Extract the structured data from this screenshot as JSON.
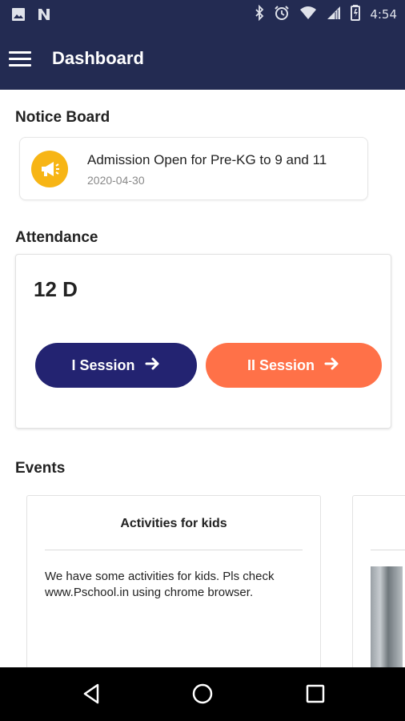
{
  "status_bar": {
    "time": "4:54",
    "left_icons": [
      "image-icon",
      "n-icon"
    ],
    "right_icons": [
      "bluetooth-icon",
      "alarm-icon",
      "wifi-icon",
      "signal-icon",
      "battery-icon"
    ]
  },
  "app_bar": {
    "title": "Dashboard",
    "menu_icon": "hamburger-menu-icon",
    "background": "#232b52"
  },
  "notice_board": {
    "heading": "Notice Board",
    "items": [
      {
        "title": "Admission Open for Pre-KG to 9 and 11",
        "date": "2020-04-30",
        "icon": "megaphone-icon",
        "icon_color": "#f7b515"
      }
    ]
  },
  "attendance": {
    "heading": "Attendance",
    "class_name": "12 D",
    "sessions": [
      {
        "label": "I Session",
        "icon": "arrow-right-icon",
        "color": "#232371"
      },
      {
        "label": "II Session",
        "icon": "arrow-right-icon",
        "color": "#ff7148"
      }
    ]
  },
  "events": {
    "heading": "Events",
    "items": [
      {
        "title": "Activities for kids",
        "description": "We have some activities for kids. Pls check www.Pschool.in using chrome browser."
      }
    ]
  },
  "nav_bar": {
    "buttons": [
      "back-icon",
      "home-icon",
      "recents-icon"
    ]
  }
}
